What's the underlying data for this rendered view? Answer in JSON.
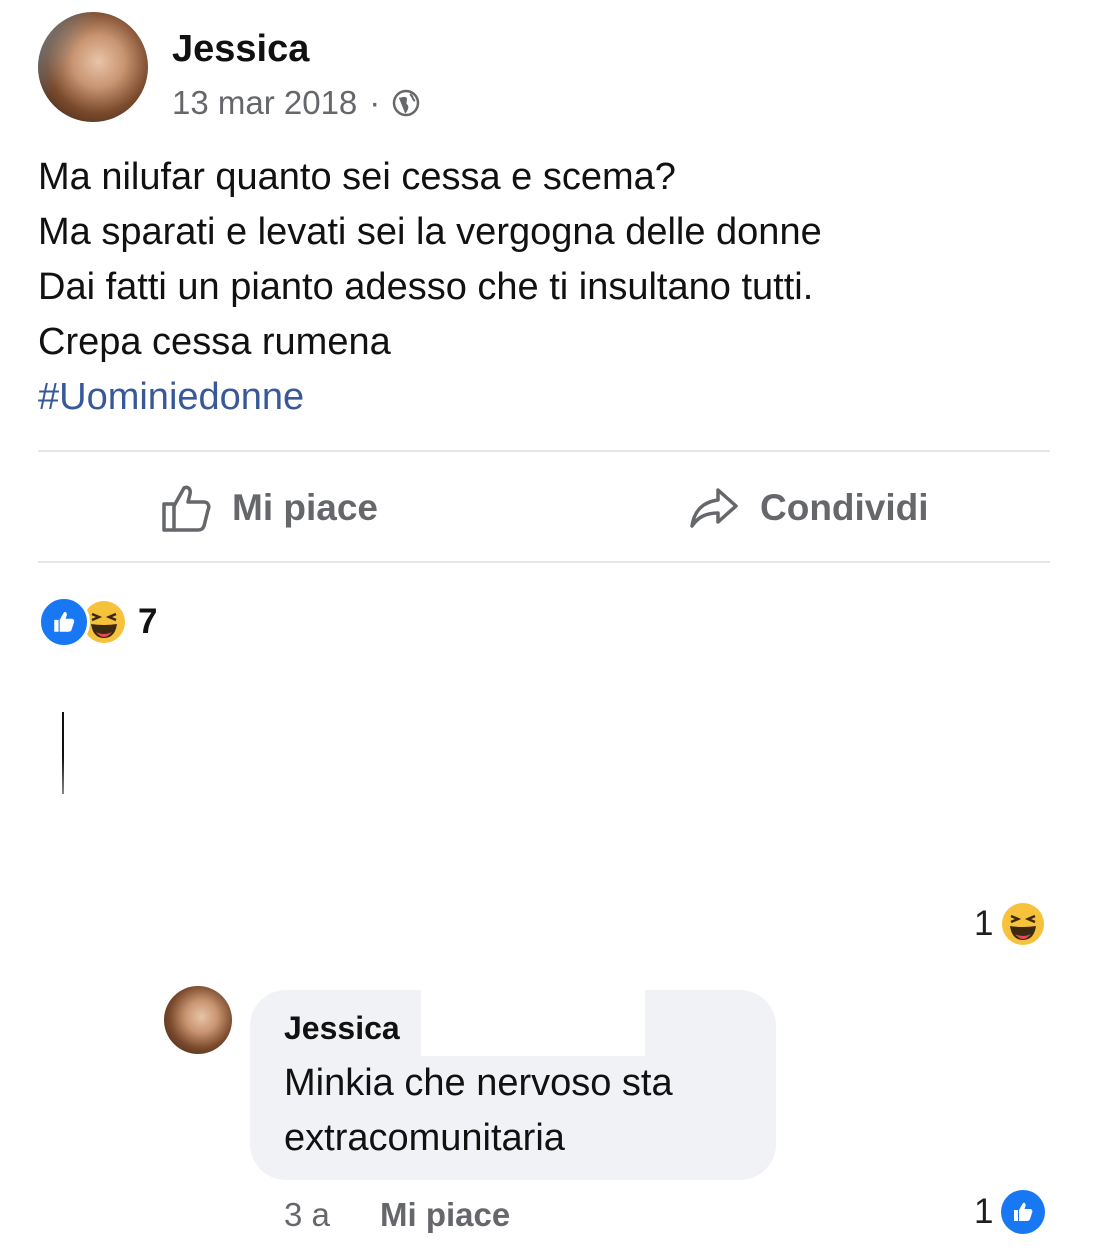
{
  "post": {
    "author": "Jessica",
    "date": "13 mar 2018",
    "separator": "·",
    "privacy_icon": "globe-icon",
    "lines": [
      "Ma nilufar quanto sei cessa e scema?",
      "Ma sparati e levati sei la vergogna delle donne",
      "Dai fatti un pianto adesso che ti insultano tutti.",
      "Crepa cessa rumena"
    ],
    "hashtag": "#Uominiedonne"
  },
  "actions": {
    "like_label": "Mi piace",
    "share_label": "Condividi"
  },
  "reactions": {
    "count": "7",
    "types": [
      "like",
      "haha"
    ]
  },
  "media_reaction": {
    "count": "1",
    "type": "haha"
  },
  "comment": {
    "author": "Jessica",
    "text": "Minkia che nervoso sta extracomunitaria",
    "time": "3 a",
    "like_label": "Mi piace",
    "reaction_count": "1",
    "reaction_type": "like"
  },
  "colors": {
    "link": "#385898",
    "like_blue": "#1877f2",
    "muted": "#65676b",
    "bubble": "#f0f2f5"
  }
}
